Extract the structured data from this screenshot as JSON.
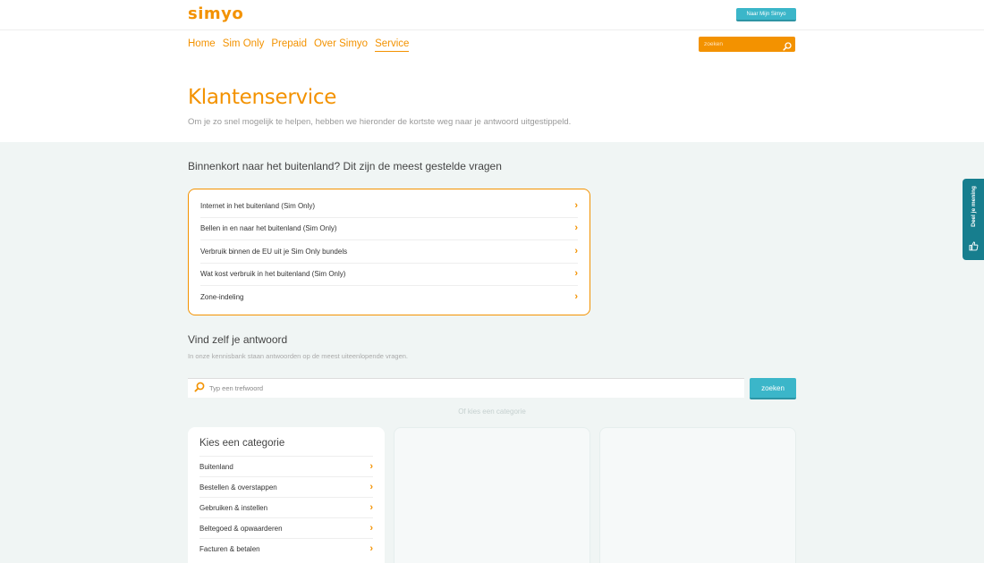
{
  "brand": {
    "logo": "simyo",
    "accent": "#f39200",
    "teal": "#3bb6c9"
  },
  "header": {
    "account_button": "Naar Mijn Simyo",
    "nav": [
      {
        "label": "Home"
      },
      {
        "label": "Sim Only"
      },
      {
        "label": "Prepaid"
      },
      {
        "label": "Over Simyo"
      },
      {
        "label": "Service",
        "active": true
      }
    ],
    "search_placeholder": "zoeken"
  },
  "hero": {
    "title": "Klantenservice",
    "subtitle": "Om je zo snel mogelijk te helpen, hebben we hieronder de kortste weg naar je antwoord uitgestippeld."
  },
  "faq": {
    "title": "Binnenkort naar het buitenland? Dit zijn de meest gestelde vragen",
    "items": [
      "Internet in het buitenland (Sim Only)",
      "Bellen in en naar het buitenland (Sim Only)",
      "Verbruik binnen de EU uit je Sim Only bundels",
      "Wat kost verbruik in het buitenland (Sim Only)",
      "Zone-indeling"
    ]
  },
  "knowledge": {
    "title": "Vind zelf je antwoord",
    "subtitle": "In onze kennisbank staan antwoorden op de meest uiteenlopende vragen.",
    "search_placeholder": "Typ een trefwoord",
    "search_button": "zoeken",
    "or_category": "Of kies een categorie"
  },
  "categories": {
    "title": "Kies een categorie",
    "items": [
      "Buitenland",
      "Bestellen & overstappen",
      "Gebruiken & instellen",
      "Beltegoed & opwaarderen",
      "Facturen & betalen"
    ]
  },
  "feedback_tab": {
    "label": "Deel je mening"
  },
  "icons": {
    "search": "search-icon",
    "chevron": "chevron-right-icon",
    "feedback": "thumbs-up-icon"
  }
}
